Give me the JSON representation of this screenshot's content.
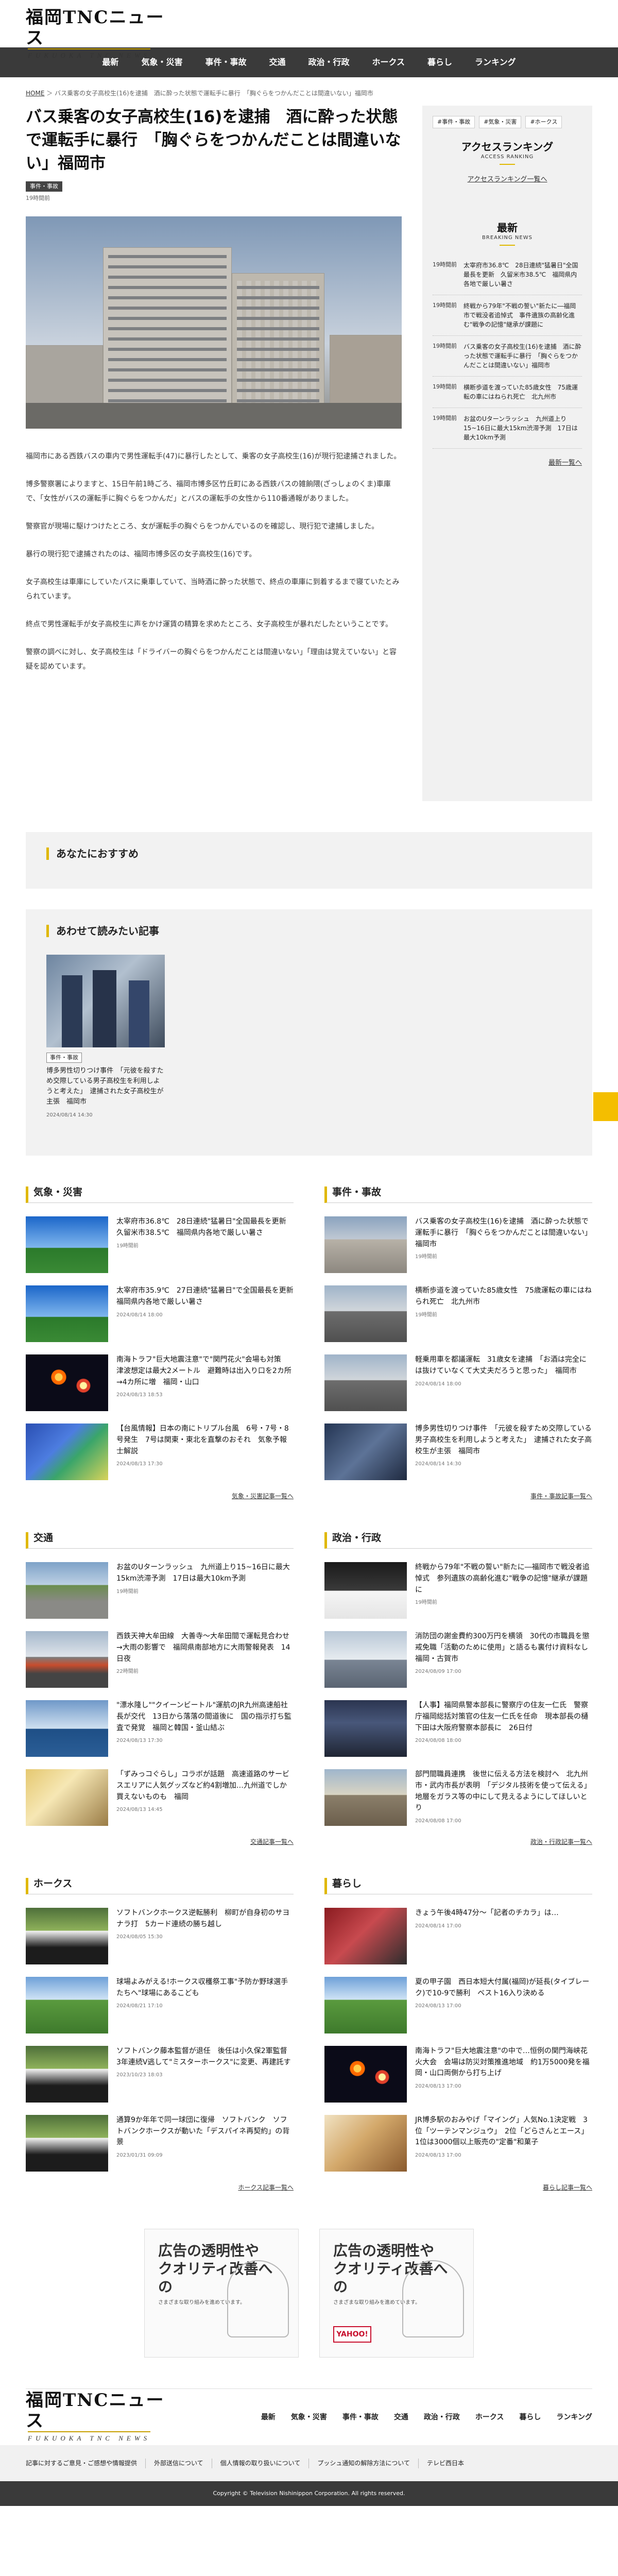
{
  "site": {
    "name_ja": "福岡TNCニュース",
    "name_en": "FUKUOKA TNC NEWS"
  },
  "nav": [
    "最新",
    "気象・災害",
    "事件・事故",
    "交通",
    "政治・行政",
    "ホークス",
    "暮らし",
    "ランキング"
  ],
  "breadcrumb": {
    "home": "HOME",
    "current": "バス乗客の女子高校生(16)を逮捕　酒に酔った状態で運転手に暴行　「胸ぐらをつかんだことは間違いない」福岡市"
  },
  "article": {
    "title": "バス乗客の女子高校生(16)を逮捕　酒に酔った状態で運転手に暴行　「胸ぐらをつかんだことは間違いない」福岡市",
    "category": "事件・事故",
    "time": "19時間前",
    "paragraphs": [
      "福岡市にある西鉄バスの車内で男性運転手(47)に暴行したとして、乗客の女子高校生(16)が現行犯逮捕されました。",
      "博多警察署によりますと、15日午前1時ごろ、福岡市博多区竹丘町にある西鉄バスの雑餉隈(ざっしょのくま)車庫で、「女性がバスの運転手に胸ぐらをつかんだ」とバスの運転手の女性から110番通報がありました。",
      "警察官が現場に駆けつけたところ、女が運転手の胸ぐらをつかんでいるのを確認し、現行犯で逮捕しました。",
      "暴行の現行犯で逮捕されたのは、福岡市博多区の女子高校生(16)です。",
      "女子高校生は車庫にしていたバスに乗車していて、当時酒に酔った状態で、終点の車庫に到着するまで寝ていたとみられています。",
      "終点で男性運転手が女子高校生に声をかけ運賃の精算を求めたところ、女子高校生が暴れだしたということです。",
      "警察の調べに対し、女子高校生は「ドライバーの胸ぐらをつかんだことは間違いない」「理由は覚えていない」と容疑を認めています。"
    ]
  },
  "sidebar": {
    "tags": [
      "#事件・事故",
      "#気象・災害",
      "#ホークス"
    ],
    "ranking_title": "アクセスランキング",
    "ranking_sub": "ACCESS RANKING",
    "ranking_link": "アクセスランキング一覧へ",
    "latest_title": "最新",
    "latest_sub": "BREAKING NEWS",
    "latest": [
      {
        "time": "19時間前",
        "text": "太宰府市36.8℃　28日連続\"猛暑日\"全国最長を更新　久留米市38.5℃　福岡県内各地で厳しい暑さ"
      },
      {
        "time": "19時間前",
        "text": "終戦から79年\"不戦の誓い\"新たに―福岡市で戦没者追悼式　事件遺族の高齢化進む\"戦争の記憶\"継承が課題に"
      },
      {
        "time": "19時間前",
        "text": "バス乗客の女子高校生(16)を逮捕　酒に酔った状態で運転手に暴行　「胸ぐらをつかんだことは間違いない」福岡市"
      },
      {
        "time": "19時間前",
        "text": "横断歩道を渡っていた85歳女性　75歳運転の車にはねられ死亡　北九州市"
      },
      {
        "time": "19時間前",
        "text": "お盆のUターンラッシュ　九州道上り15~16日に最大15km渋滞予測　17日は最大10km予測"
      }
    ],
    "latest_more": "最新一覧へ"
  },
  "recommend_title": "あなたにおすすめ",
  "related": {
    "title": "あわせて読みたい記事",
    "card": {
      "tag": "事件・事故",
      "text": "博多男性切りつけ事件　「元彼を殺すため交際している男子高校生を利用しようと考えた」　逮捕された女子高校生が主張　福岡市",
      "date": "2024/08/14 14:30"
    }
  },
  "categories": [
    {
      "name": "気象・災害",
      "more": "気象・災害記事一覧へ",
      "items": [
        {
          "text": "太宰府市36.8℃　28日連続\"猛暑日\"全国最長を更新　久留米市38.5℃　福岡県内各地で厳しい暑さ",
          "date": "19時間前",
          "th": "sky"
        },
        {
          "text": "太宰府市35.9℃　27日連続\"猛暑日\"で全国最長を更新　福岡県内各地で厳しい暑さ",
          "date": "2024/08/14 18:00",
          "th": "sky"
        },
        {
          "text": "南海トラフ\"巨大地震注意\"で\"関門花火\"会場も対策　津波想定は最大2メートル　避難時は出入り口を2カ所→4カ所に増　福岡・山口",
          "date": "2024/08/13 18:53",
          "th": "fire"
        },
        {
          "text": "【台風情報】日本の南にトリプル台風　6号・7号・8号発生　7号は関東・東北を直撃のおそれ　気象予報士解説",
          "date": "2024/08/13 17:30",
          "th": "map"
        }
      ]
    },
    {
      "name": "事件・事故",
      "more": "事件・事故記事一覧へ",
      "items": [
        {
          "text": "バス乗客の女子高校生(16)を逮捕　酒に酔った状態で運転手に暴行　「胸ぐらをつかんだことは間違いない」福岡市",
          "date": "19時間前",
          "th": "bld"
        },
        {
          "text": "横断歩道を渡っていた85歳女性　75歳運転の車にはねられ死亡　北九州市",
          "date": "19時間前",
          "th": "street"
        },
        {
          "text": "軽乗用車を都議運転　31歳女を逮捕　「お酒は完全には抜けていなくて大丈夫だろうと思った」　福岡市",
          "date": "2024/08/14 18:00",
          "th": "street"
        },
        {
          "text": "博多男性切りつけ事件　「元彼を殺すため交際している男子高校生を利用しようと考えた」　逮捕された女子高校生が主張　福岡市",
          "date": "2024/08/14 14:30",
          "th": "police"
        }
      ]
    },
    {
      "name": "交通",
      "more": "交通記事一覧へ",
      "items": [
        {
          "text": "お盆のUターンラッシュ　九州道上り15~16日に最大15km渋滞予測　17日は最大10km予測",
          "date": "19時間前",
          "th": "road"
        },
        {
          "text": "西鉄天神大牟田線　大善寺～大牟田間で運転見合わせ→大雨の影響で　福岡県南部地方に大雨警報発表　14日夜",
          "date": "22時間前",
          "th": "train"
        },
        {
          "text": "\"漂水隆し\"\"クイーンビートル\"運航のJR九州高速船社長が交代　13日から落落の間道後に　国の指示打ち監査で発覚　福岡と韓国・釜山結ぶ",
          "date": "2024/08/13 17:30",
          "th": "ship"
        },
        {
          "text": "「ずみっコぐらし」コラボが話題　高速道路のサービスエリアに人気グッズなど約4割増加…九州道でしか買えないものも　福岡",
          "date": "2024/08/13 14:45",
          "th": "shop"
        }
      ]
    },
    {
      "name": "政治・行政",
      "more": "政治・行政記事一覧へ",
      "items": [
        {
          "text": "終戦から79年\"不戦の誓い\"新たに―福岡市で戦没者追悼式　参列遺族の高齢化進む\"戦争の記憶\"継承が課題に",
          "date": "19時間前",
          "th": "flag"
        },
        {
          "text": "消防団の謝金費約300万円を横領　30代の市職員を懲戒免職「活動のために使用」と語るも裏付け資料なし　福岡・古賀市",
          "date": "2024/08/09 17:00",
          "th": "office"
        },
        {
          "text": "【人事】福岡県警本部長に警察庁の住友一仁氏　警察庁福岡総括対策官の住友一仁氏を任命　現本部長の樋下田は大阪府警察本部長に　26日付",
          "date": "2024/08/08 18:00",
          "th": "person"
        },
        {
          "text": "部門間職員連携　後世に伝える方法を検討へ　北九州市・武内市長が表明　「デジタル技術を使って伝える」地層をガラス等の中にして見えるようにしてほしいとり",
          "date": "2024/08/08 17:00",
          "th": "rubble"
        }
      ]
    },
    {
      "name": "ホークス",
      "more": "ホークス記事一覧へ",
      "items": [
        {
          "text": "ソフトバンクホークス逆転勝利　柳町が自身初のサヨナラ打　5カード連続の勝ち越し",
          "date": "2024/08/05 15:30",
          "th": "baseball"
        },
        {
          "text": "球場よみがえる!ホークス収穫祭工事\"予防か野球選手たちへ\"球場にあるこども",
          "date": "2024/08/21 17:10",
          "th": "stadium"
        },
        {
          "text": "ソフトバンク藤本監督が退任　後任は小久保2軍監督　3年連続V逃して\"ミスターホークス\"に変更、再建託す",
          "date": "2023/10/23 18:03",
          "th": "baseball"
        },
        {
          "text": "通算9か年年で同一球団に復帰　ソフトバンク　ソフトバンクホークスが動いた「デスパイネ再契約」の背景",
          "date": "2023/01/31 09:09",
          "th": "baseball"
        }
      ]
    },
    {
      "name": "暮らし",
      "more": "暮らし記事一覧へ",
      "items": [
        {
          "text": "きょう午後4時47分～「記者のチカラ」は…",
          "date": "2024/08/14 17:00",
          "th": "studio"
        },
        {
          "text": "夏の甲子園　西日本短大付属(福岡)が延長(タイブレーク)で10-9で勝利　ベスト16入り決める",
          "date": "2024/08/13 17:00",
          "th": "stadium"
        },
        {
          "text": "南海トラフ\"巨大地震注意\"の中で…恒例の関門海峡花火大会　会場は防災対策推進地域　約1万5000発を福岡・山口両側から打ち上げ",
          "date": "2024/08/13 17:00",
          "th": "fire"
        },
        {
          "text": "JR博多駅のおみやげ「マイング」人気No.1決定戦　3位「ツーテンマンジュウ」　2位「どらさんとエース」　1位は3000個以上販売の\"定番\"和菓子",
          "date": "2024/08/13 17:00",
          "th": "food"
        }
      ]
    }
  ],
  "ads": [
    {
      "big": "広告の透明性や\nクオリティ改善への",
      "small": "さまざまな取り組みを進めています。"
    },
    {
      "big": "広告の透明性や\nクオリティ改善への",
      "small": "さまざまな取り組みを進めています。",
      "brand": "YAHOO!"
    }
  ],
  "footer": {
    "nav": [
      "最新",
      "気象・災害",
      "事件・事故",
      "交通",
      "政治・行政",
      "ホークス",
      "暮らし",
      "ランキング"
    ],
    "links": [
      "記事に対するご意見・ご感想や情報提供",
      "外部送信について",
      "個人情報の取り扱いについて",
      "プッシュ通知の解除方法について",
      "テレビ西日本"
    ],
    "copyright": "Copyright © Television Nishinippon Corporation. All rights reserved."
  },
  "colors": {
    "accent": "#e0b800",
    "nav_bg": "#3a3a3a",
    "side_bg": "#f1f1f1"
  }
}
